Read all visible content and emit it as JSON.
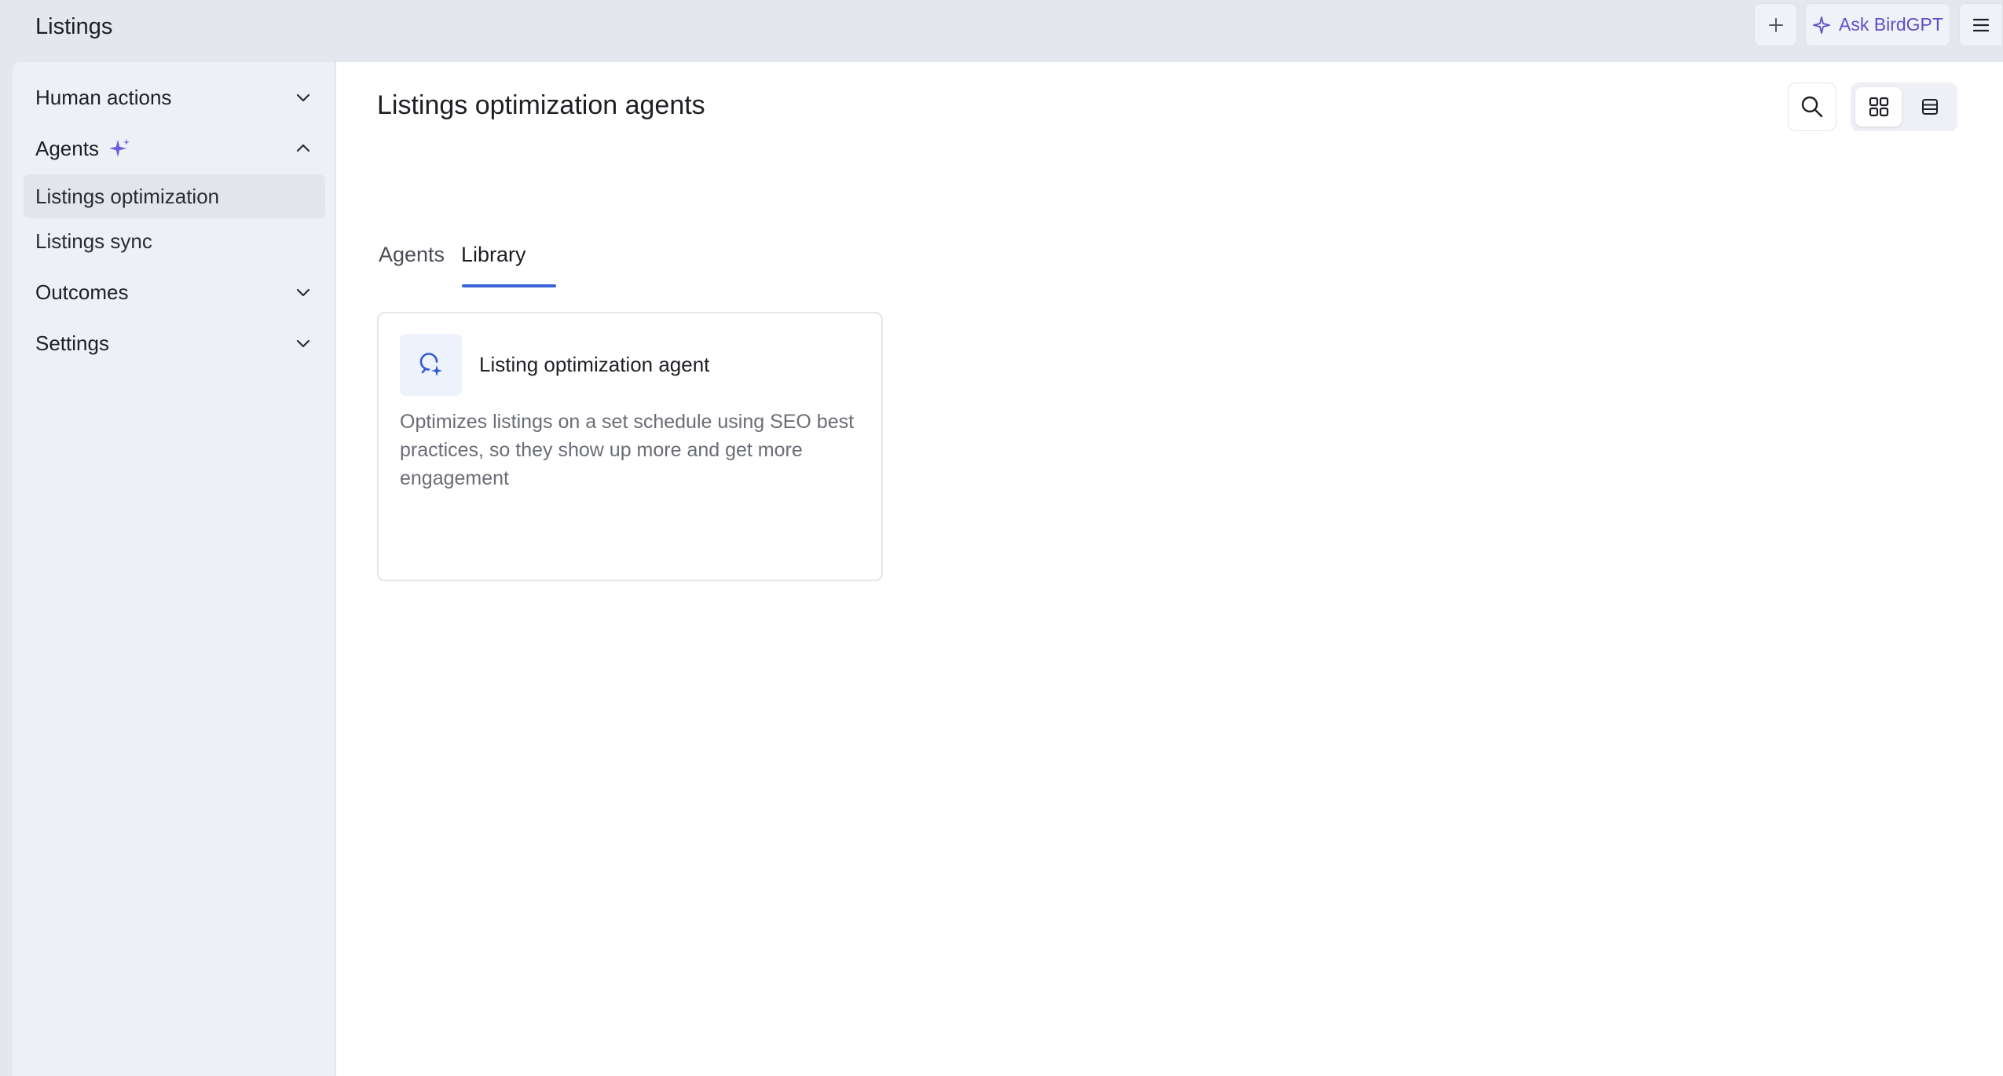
{
  "app": {
    "title": "Listings",
    "ask_label": "Ask BirdGPT"
  },
  "sidebar": {
    "groups": [
      {
        "label": "Human actions",
        "expanded": false
      },
      {
        "label": "Agents",
        "expanded": true
      },
      {
        "label": "Outcomes",
        "expanded": false
      },
      {
        "label": "Settings",
        "expanded": false
      }
    ],
    "agent_items": [
      {
        "label": "Listings optimization",
        "active": true
      },
      {
        "label": "Listings sync",
        "active": false
      }
    ]
  },
  "main": {
    "title": "Listings optimization agents",
    "tabs": [
      {
        "label": "Agents",
        "active": false
      },
      {
        "label": "Library",
        "active": true
      }
    ],
    "view_mode": "grid",
    "cards": [
      {
        "title": "Listing optimization agent",
        "description": "Optimizes listings on a set schedule using SEO best practices, so they show up more and get more engagement",
        "icon": "search-sparkle-icon"
      }
    ]
  },
  "colors": {
    "accent": "#3b63d6",
    "ai_purple": "#5a50c8",
    "sidebar_bg": "#eff0f5",
    "frame_bg": "#e5e7ef"
  }
}
